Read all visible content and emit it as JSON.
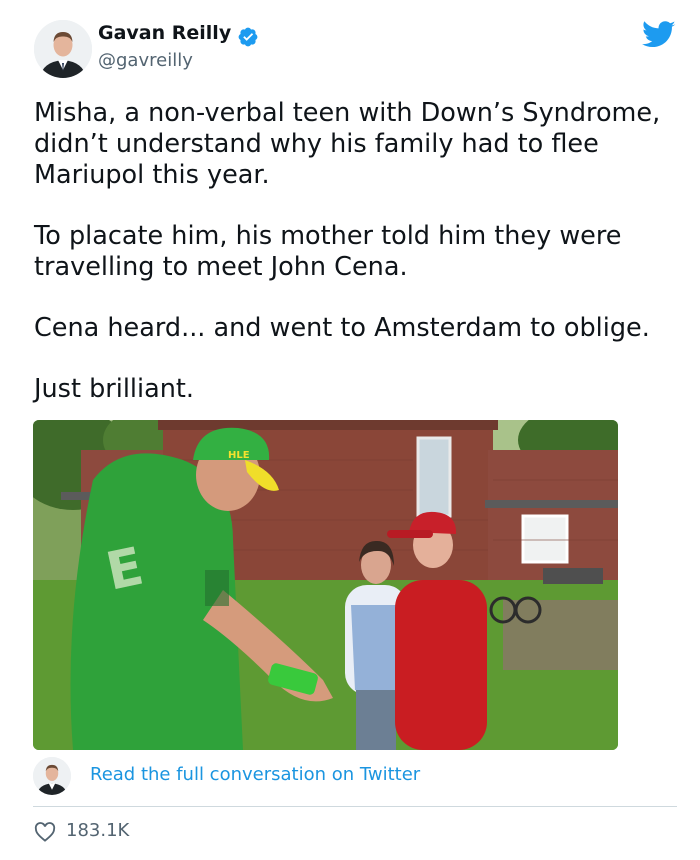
{
  "author": {
    "name": "Gavan Reilly",
    "handle": "@gavreilly",
    "verified": true
  },
  "icons": {
    "avatar": "person-avatar",
    "verified": "verified-badge-icon",
    "brand": "twitter-bird-icon",
    "like": "heart-icon"
  },
  "tweet": {
    "paragraphs": [
      "Misha, a non-verbal teen with Down’s Syndrome, didn’t understand why his family had to flee Mariupol this year.",
      "To placate him, his mother told him they were travelling to meet John Cena.",
      "Cena heard... and went to Amsterdam to oblige.",
      "Just brilliant."
    ]
  },
  "media": {
    "cap_text": "HLE"
  },
  "footer": {
    "read_link": "Read the full conversation on Twitter",
    "like_count": "183.1K"
  },
  "colors": {
    "link": "#1b95e0",
    "verified": "#1d9bf0",
    "twitter_blue": "#1d9bf0",
    "muted": "#536471"
  }
}
